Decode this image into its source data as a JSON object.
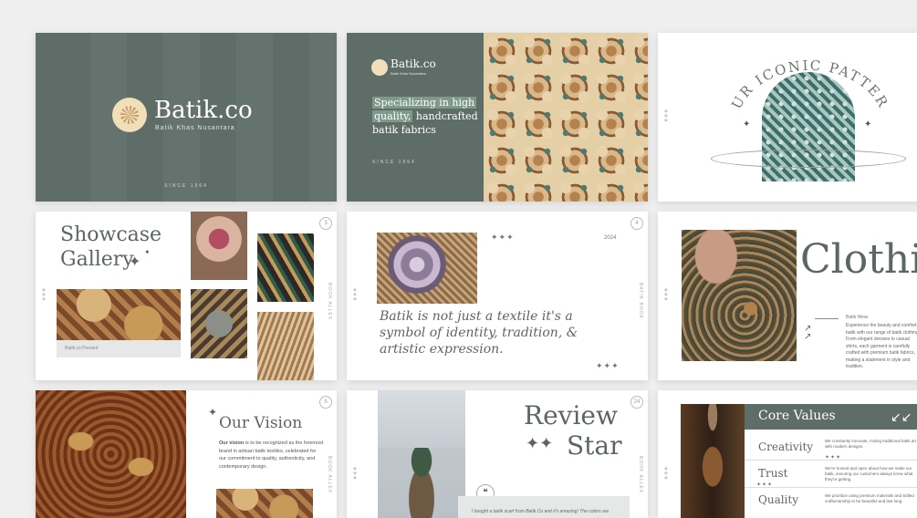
{
  "slide1": {
    "brand": "Batik.co",
    "tagline": "Batik Khas Nusantara",
    "since": "SINCE 1964"
  },
  "slide2": {
    "brand": "Batik.co",
    "tagline": "Batik Khas Nusantara",
    "headline_1": "Specializing in high",
    "headline_2": "quality,",
    "headline_3": " handcrafted",
    "headline_4": "batik fabrics",
    "since": "SINCE 1964"
  },
  "slide3": {
    "arch_title": "OUR ICONIC PATTERN"
  },
  "slide4": {
    "title_1": "Showcase",
    "title_2": "Gallery",
    "caption": "Batik.co Present",
    "num": "3",
    "vertical": "BOOK ALLEX"
  },
  "slide5": {
    "year": "2024",
    "quote": "Batik is not just a textile it's a symbol of identity, tradition, & artistic expression.",
    "num": "4",
    "vertical": "BATIK BOOK"
  },
  "slide6": {
    "title": "Clothing",
    "subtitle": "Batik Wear",
    "body": "Experience the beauty and comfort of batik with our range of batik clothing. From elegant dresses to casual shirts, each garment is carefully crafted with premium batik fabrics, making a statement in style and tradition."
  },
  "slide7": {
    "title": "Our Vision",
    "body_bold": "Our vision",
    "body": " is to be recognized as the foremost brand in artisan batik textiles, celebrated for our commitment to quality, authenticity, and contemporary design.",
    "num": "5",
    "vertical": "BOOK ALLEX"
  },
  "slide8": {
    "title_1": "Review",
    "title_2": "Star",
    "quote": "I bought a batik scarf from Batik.Co and it's amazing! The colors are",
    "num": "24",
    "vertical": "BOOK ALLEX"
  },
  "slide9": {
    "title": "Core Values",
    "values": [
      {
        "label": "Creativity",
        "text": "We constantly innovate, mixing traditional batik art with modern designs."
      },
      {
        "label": "Trust",
        "text": "We're honest and open about how we make our batik, ensuring our customers always know what they're getting."
      },
      {
        "label": "Quality",
        "text": "We prioritize using premium materials and skilled craftsmanship to be beautiful and last long."
      }
    ]
  },
  "colors": {
    "accent_green": "#5f6d68",
    "highlight": "#6f8a7e",
    "background": "#efefef"
  }
}
